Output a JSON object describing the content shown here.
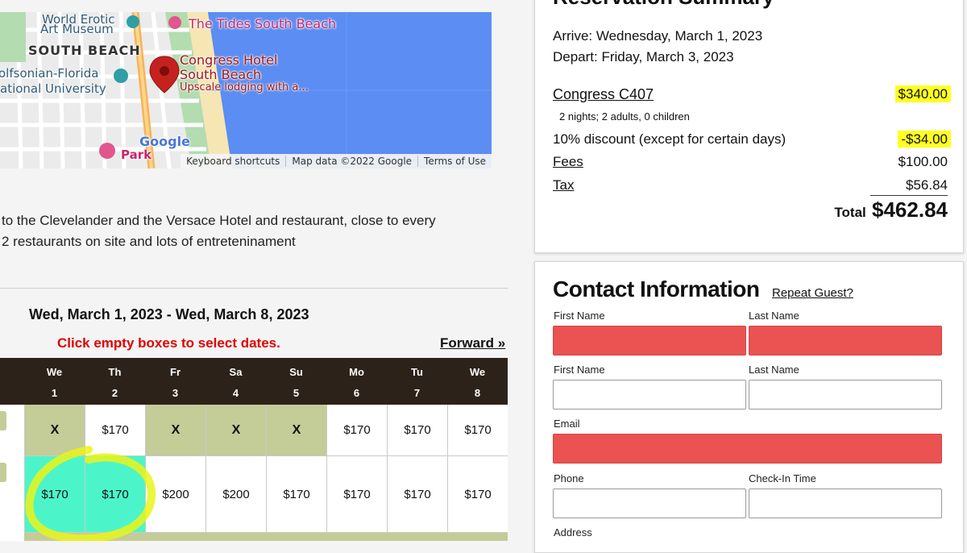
{
  "map": {
    "labels": {
      "museum_line1": "World Erotic",
      "museum_line2": "Art Museum",
      "tides": "The Tides South Beach",
      "south_beach": "SOUTH BEACH",
      "congress_line1": "Congress Hotel",
      "congress_line2": "South Beach",
      "congress_line3": "Upscale lodging with a...",
      "wolfsonian_line1": "olfsonian-Florida",
      "wolfsonian_line2": "ational University",
      "google": "Google",
      "park": "Park"
    },
    "footer": {
      "shortcuts": "Keyboard shortcuts",
      "map_data": "Map data ©2022 Google",
      "terms": "Terms of Use"
    },
    "colors": {
      "water": "#5b8df3",
      "land": "#ebebeb",
      "pin": "#c5221f"
    }
  },
  "description": {
    "line1": "to the Clevelander and the Versace Hotel and restaurant, close to every",
    "line2": "2 restaurants on site and lots of entreteninament"
  },
  "calendar": {
    "range_title": "Wed, March 1, 2023 - Wed, March 8, 2023",
    "hint": "Click empty boxes to select dates.",
    "forward": "Forward »",
    "days": [
      {
        "name": "We",
        "num": "1"
      },
      {
        "name": "Th",
        "num": "2"
      },
      {
        "name": "Fr",
        "num": "3"
      },
      {
        "name": "Sa",
        "num": "4"
      },
      {
        "name": "Su",
        "num": "5"
      },
      {
        "name": "Mo",
        "num": "6"
      },
      {
        "name": "Tu",
        "num": "7"
      },
      {
        "name": "We",
        "num": "8"
      }
    ],
    "rows": [
      [
        {
          "text": "X",
          "state": "na"
        },
        {
          "text": "$170",
          "state": "open"
        },
        {
          "text": "X",
          "state": "na"
        },
        {
          "text": "X",
          "state": "na"
        },
        {
          "text": "X",
          "state": "na"
        },
        {
          "text": "$170",
          "state": "open"
        },
        {
          "text": "$170",
          "state": "open"
        },
        {
          "text": "$170",
          "state": "open"
        }
      ],
      [
        {
          "text": "$170",
          "state": "selected"
        },
        {
          "text": "$170",
          "state": "selected"
        },
        {
          "text": "$200",
          "state": "open"
        },
        {
          "text": "$200",
          "state": "open"
        },
        {
          "text": "$170",
          "state": "open"
        },
        {
          "text": "$170",
          "state": "open"
        },
        {
          "text": "$170",
          "state": "open"
        },
        {
          "text": "$170",
          "state": "open"
        }
      ]
    ],
    "colors": {
      "header": "#2d2219",
      "unavailable": "#c4cc98",
      "selected": "#4cf5c9"
    }
  },
  "summary": {
    "title": "Reservation Summary",
    "arrive": "Arrive: Wednesday, March 1, 2023",
    "depart": "Depart: Friday, March 3, 2023",
    "room_name": "Congress C407",
    "room_price": "$340.00",
    "room_detail": "2 nights; 2 adults, 0 children",
    "discount_label": "10% discount (except for certain days)",
    "discount_value": "-$34.00",
    "fees_label": "Fees",
    "fees_value": "$100.00",
    "tax_label": "Tax",
    "tax_value": "$56.84",
    "total_label": "Total",
    "total_value": "$462.84",
    "highlight_color": "#ffff22"
  },
  "contact": {
    "title": "Contact Information",
    "repeat_guest": "Repeat Guest?",
    "first_name_1": "First Name",
    "last_name_1": "Last Name",
    "first_name_2": "First Name",
    "last_name_2": "Last Name",
    "email": "Email",
    "phone": "Phone",
    "checkin_time": "Check-In Time",
    "address": "Address",
    "error_color": "#eb5252"
  }
}
